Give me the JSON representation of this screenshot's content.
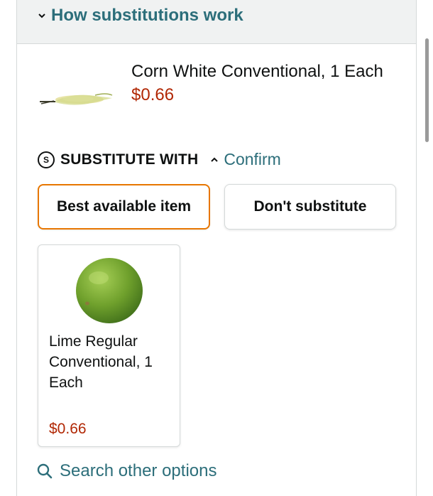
{
  "how_substitutions": {
    "label": "How substitutions work",
    "icon": "chevron-down-icon"
  },
  "original_item": {
    "title": "Corn White Conventional, 1 Each",
    "price": "$0.66",
    "image": "corn-image"
  },
  "substitute": {
    "label": "SUBSTITUTE WITH",
    "icon_letter": "S",
    "confirm_label": "Confirm",
    "confirm_icon": "chevron-up-icon"
  },
  "options": {
    "best_label": "Best available item",
    "dont_label": "Don't substitute",
    "selected": "best"
  },
  "suggested_item": {
    "title": "Lime Regular Conventional, 1 Each",
    "price": "$0.66",
    "image": "lime-image"
  },
  "search": {
    "label": "Search other options",
    "icon": "search-icon"
  },
  "colors": {
    "link": "#2c6e7a",
    "price": "#b12704",
    "selected_border": "#e77600",
    "header_bg": "#f0f2f2"
  }
}
